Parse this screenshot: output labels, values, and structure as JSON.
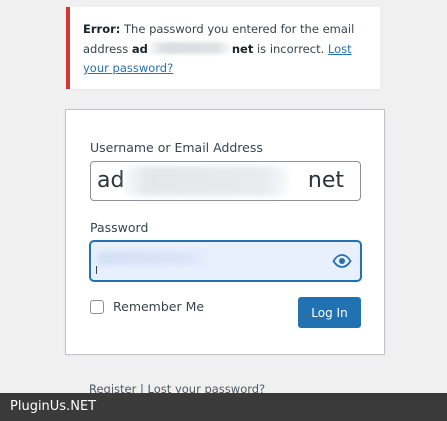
{
  "error_notice": {
    "prefix": "Error:",
    "message_before": "The password you entered for the email address",
    "email_start": "ad",
    "email_end": "net",
    "message_after": "is incorrect.",
    "link_text": "Lost your password?",
    "accent_color": "#d63638"
  },
  "login_form": {
    "username_label": "Username or Email Address",
    "username_value_start": "ad",
    "username_value_end": "net",
    "password_label": "Password",
    "remember_label": "Remember Me",
    "remember_checked": false,
    "submit_label": "Log In",
    "button_color": "#2271b1",
    "eye_icon": "eye-icon"
  },
  "nav_links": {
    "register": "Register",
    "separator": "|",
    "lost_password": "Lost your password?"
  },
  "watermark": {
    "text": "PluginUs.NET"
  }
}
